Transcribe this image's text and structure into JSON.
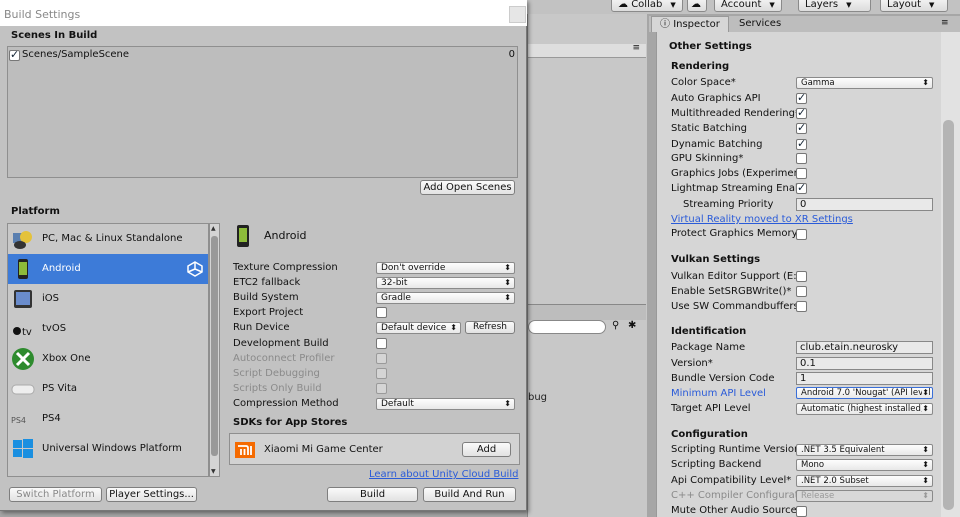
{
  "dialog": {
    "title": "Build Settings",
    "scenes_header": "Scenes In Build",
    "scenes": [
      {
        "name": "Scenes/SampleScene",
        "index": "0",
        "checked": true
      }
    ],
    "add_open_scenes": "Add Open Scenes",
    "platform_header": "Platform",
    "platforms": [
      {
        "label": "PC, Mac & Linux Standalone",
        "icon": "pc-mac-linux-icon"
      },
      {
        "label": "Android",
        "icon": "android-icon",
        "selected": true
      },
      {
        "label": "iOS",
        "icon": "ios-icon"
      },
      {
        "label": "tvOS",
        "icon": "tvos-icon"
      },
      {
        "label": "Xbox One",
        "icon": "xbox-icon"
      },
      {
        "label": "PS Vita",
        "icon": "ps-vita-icon"
      },
      {
        "label": "PS4",
        "icon": "ps4-icon"
      },
      {
        "label": "Universal Windows Platform",
        "icon": "windows-icon"
      }
    ],
    "selected_platform_title": "Android",
    "settings": {
      "texture_compression": {
        "label": "Texture Compression",
        "value": "Don't override"
      },
      "etc2_fallback": {
        "label": "ETC2 fallback",
        "value": "32-bit"
      },
      "build_system": {
        "label": "Build System",
        "value": "Gradle"
      },
      "export_project": {
        "label": "Export Project"
      },
      "run_device": {
        "label": "Run Device",
        "value": "Default device",
        "refresh": "Refresh"
      },
      "development_build": {
        "label": "Development Build"
      },
      "autoconnect_profiler": {
        "label": "Autoconnect Profiler"
      },
      "script_debugging": {
        "label": "Script Debugging"
      },
      "scripts_only_build": {
        "label": "Scripts Only Build"
      },
      "compression_method": {
        "label": "Compression Method",
        "value": "Default"
      }
    },
    "sdks_header": "SDKs for App Stores",
    "sdk": {
      "name": "Xiaomi Mi Game Center",
      "add": "Add"
    },
    "cloud_link": "Learn about Unity Cloud Build",
    "switch_platform": "Switch Platform",
    "player_settings": "Player Settings...",
    "build": "Build",
    "build_and_run": "Build And Run"
  },
  "toolbar": {
    "collab": "Collab",
    "account": "Account",
    "layers": "Layers",
    "layout": "Layout"
  },
  "middle": {
    "text": "bug"
  },
  "inspector": {
    "tabs": [
      "Inspector",
      "Services"
    ],
    "other_settings": "Other Settings",
    "rendering": "Rendering",
    "color_space": {
      "label": "Color Space*",
      "value": "Gamma"
    },
    "auto_graphics_api": "Auto Graphics API",
    "multithreaded_rendering": "Multithreaded Rendering*",
    "static_batching": "Static Batching",
    "dynamic_batching": "Dynamic Batching",
    "gpu_skinning": "GPU Skinning*",
    "graphics_jobs": "Graphics Jobs (Experimen",
    "lightmap_streaming": "Lightmap Streaming Enab",
    "streaming_priority": {
      "label": "Streaming Priority",
      "value": "0"
    },
    "vr_link": "Virtual Reality moved to XR Settings",
    "protect_graphics_memory": "Protect Graphics Memory",
    "vulkan_settings": "Vulkan Settings",
    "vulkan_editor_support": "Vulkan Editor Support (E:",
    "enable_setsrgbwrite": "Enable SetSRGBWrite()*",
    "use_sw_commandbuffers": "Use SW Commandbuffers",
    "identification": "Identification",
    "package_name": {
      "label": "Package Name",
      "value": "club.etain.neurosky"
    },
    "version": {
      "label": "Version*",
      "value": "0.1"
    },
    "bundle_version_code": {
      "label": "Bundle Version Code",
      "value": "1"
    },
    "min_api_level": {
      "label": "Minimum API Level",
      "value": "Android 7.0 'Nougat' (API level"
    },
    "target_api_level": {
      "label": "Target API Level",
      "value": "Automatic (highest installed)"
    },
    "configuration": "Configuration",
    "scripting_runtime": {
      "label": "Scripting Runtime Version",
      "value": ".NET 3.5 Equivalent"
    },
    "scripting_backend": {
      "label": "Scripting Backend",
      "value": "Mono"
    },
    "api_compat": {
      "label": "Api Compatibility Level*",
      "value": ".NET 2.0 Subset"
    },
    "cpp_compiler": {
      "label": "C++ Compiler Configurat",
      "value": "Release"
    },
    "mute_other_audio": "Mute Other Audio Sources"
  }
}
